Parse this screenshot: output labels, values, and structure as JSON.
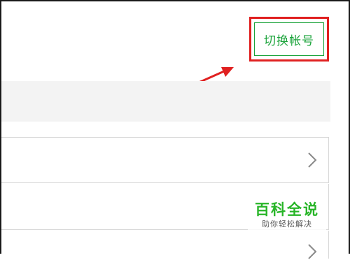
{
  "header": {
    "switch_account_label": "切换帐号"
  },
  "annotation": {
    "highlight_color": "#e02020",
    "arrow_color": "#e02020"
  },
  "theme": {
    "accent": "#1aa33a"
  },
  "list": {
    "rows": [
      {
        "chevron_icon": "chevron-right-icon"
      },
      {
        "chevron_icon": null
      },
      {
        "chevron_icon": "chevron-right-icon"
      }
    ]
  },
  "watermark": {
    "title": "百科全说",
    "subtitle": "助你轻松解决"
  }
}
